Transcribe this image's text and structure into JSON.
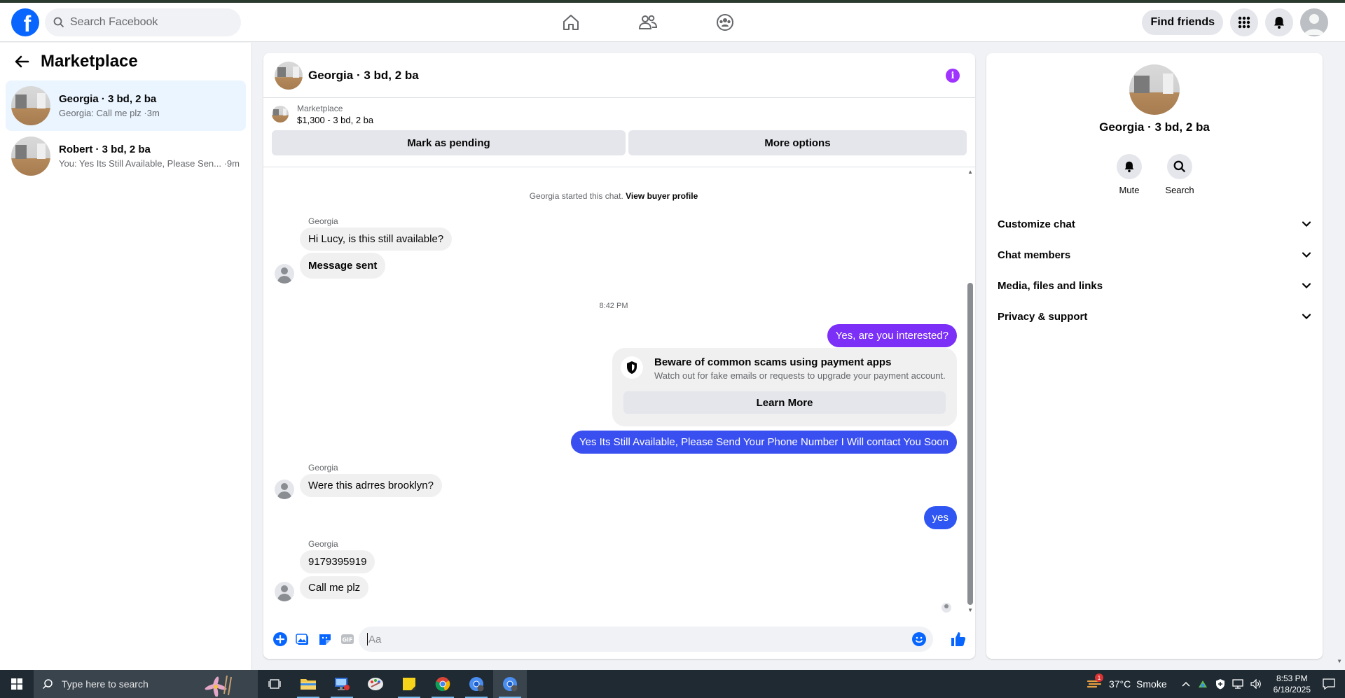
{
  "topbar": {
    "logo_letter": "f",
    "search_placeholder": "Search Facebook",
    "find_friends": "Find friends"
  },
  "sidebar": {
    "title": "Marketplace",
    "conversations": [
      {
        "name": "Georgia · 3 bd, 2 ba",
        "preview": "Georgia: Call me plz ·3m",
        "active": true
      },
      {
        "name": "Robert · 3 bd, 2 ba",
        "preview": "You: Yes Its Still Available, Please Sen... ·9m",
        "active": false
      }
    ]
  },
  "chat": {
    "title": "Georgia · 3 bd, 2 ba",
    "info_glyph": "i",
    "listing_label": "Marketplace",
    "listing_price": "$1,300 - 3 bd, 2 ba",
    "mark_pending": "Mark as pending",
    "more_options": "More options",
    "started_text": "Georgia started this chat.",
    "view_buyer": "View buyer profile",
    "time_divider": "8:42 PM",
    "messages": [
      {
        "sender": "Georgia",
        "text": "Hi Lucy, is this still available?"
      },
      {
        "text": "Message sent"
      },
      {
        "text": "Yes, are you interested?"
      },
      {
        "text": "Yes Its Still Available, Please Send Your Phone Number I Will contact You Soon"
      },
      {
        "sender": "Georgia",
        "text": "Were this adrres brooklyn?"
      },
      {
        "text": "yes"
      },
      {
        "sender": "Georgia",
        "text": "9179395919"
      },
      {
        "text": "Call me plz"
      }
    ],
    "scam": {
      "title": "Beware of common scams using payment apps",
      "subtitle": "Watch out for fake emails or requests to upgrade your payment account.",
      "button": "Learn More"
    },
    "composer_placeholder": "Aa",
    "colors": {
      "purple": "#7b2ff7",
      "blue": "#3a4ff0",
      "messenger_blue": "#0866ff"
    }
  },
  "details": {
    "name": "Georgia · 3 bd, 2 ba",
    "mute": "Mute",
    "search": "Search",
    "sections": [
      "Customize chat",
      "Chat members",
      "Media, files and links",
      "Privacy & support"
    ]
  },
  "taskbar": {
    "search_placeholder": "Type here to search",
    "weather": "37°C  Smoke",
    "weather_badge": "1",
    "time": "8:53 PM",
    "date": "6/18/2025"
  }
}
